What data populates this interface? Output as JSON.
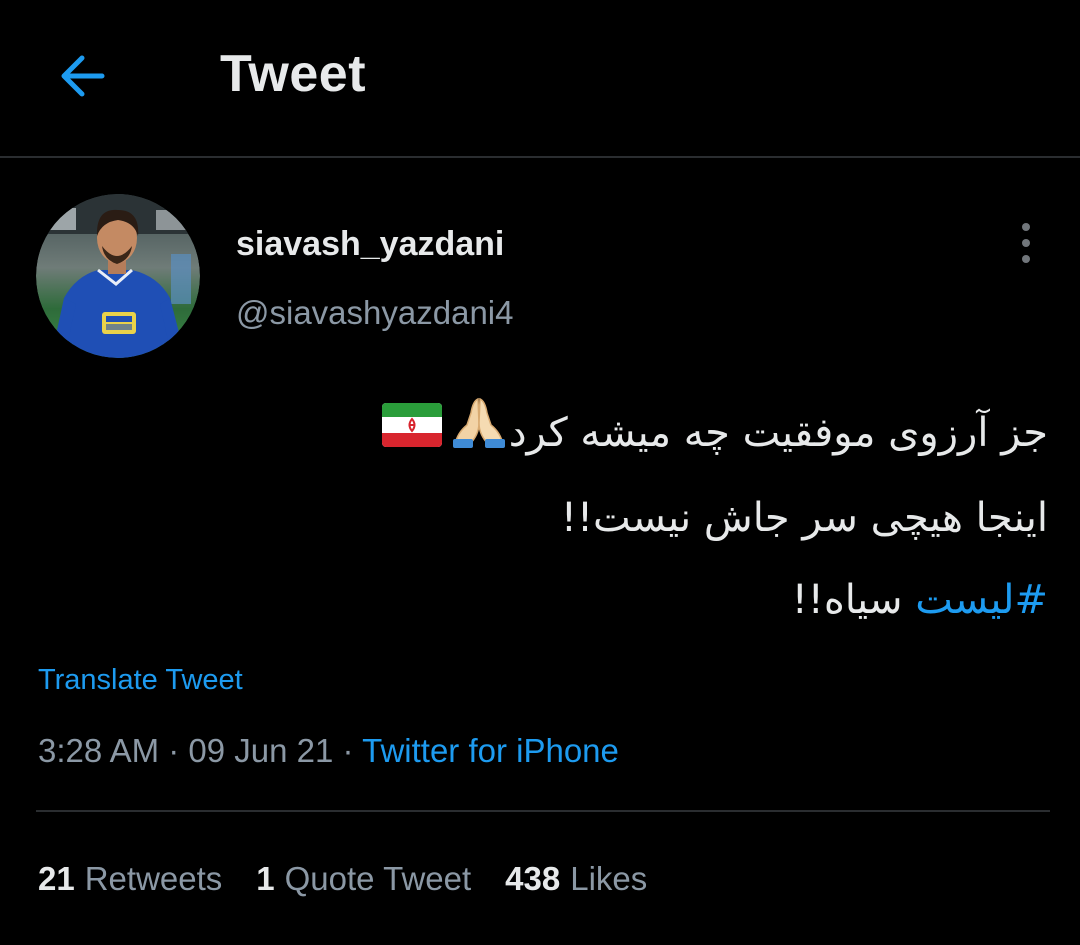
{
  "header": {
    "title": "Tweet",
    "back_icon": "arrow-left-icon",
    "accent_color": "#1d9bf0"
  },
  "author": {
    "display_name": "siavash_yazdani",
    "handle": "@siavashyazdani4",
    "avatar_icon": "user-avatar"
  },
  "tweet": {
    "line1": "جز آرزوی موفقیت چه میشه کرد",
    "line2": "اینجا هیچی سر جاش نیست!!",
    "hashtag": "#لیست",
    "line3_rest": " سیاه!!",
    "emojis": [
      "folded-hands-icon",
      "iran-flag-icon"
    ]
  },
  "translate_label": "Translate Tweet",
  "meta": {
    "time": "3:28 AM",
    "sep1": " · ",
    "date": "09 Jun 21",
    "sep2": " · ",
    "source": "Twitter for iPhone"
  },
  "stats": {
    "retweets_count": "21",
    "retweets_label": "Retweets",
    "quotes_count": "1",
    "quotes_label": "Quote Tweet",
    "likes_count": "438",
    "likes_label": "Likes"
  }
}
